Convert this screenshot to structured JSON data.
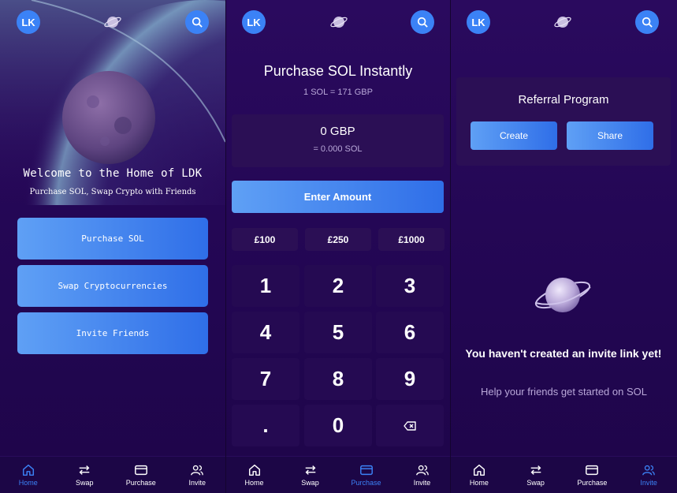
{
  "colors": {
    "accent": "#3b82f6",
    "bg": "#220652",
    "card": "#2b0f55"
  },
  "avatar_initials": "LK",
  "nav": [
    {
      "label": "Home",
      "icon": "home-icon"
    },
    {
      "label": "Swap",
      "icon": "swap-icon"
    },
    {
      "label": "Purchase",
      "icon": "card-icon"
    },
    {
      "label": "Invite",
      "icon": "users-icon"
    }
  ],
  "home": {
    "welcome": "Welcome to the Home of LDK",
    "subtitle": "Purchase SOL, Swap Crypto with Friends",
    "buttons": [
      "Purchase SOL",
      "Swap Cryptocurrencies",
      "Invite Friends"
    ],
    "active_nav": "Home"
  },
  "purchase": {
    "title": "Purchase SOL Instantly",
    "rate": "1 SOL = 171 GBP",
    "amount_gbp": "0 GBP",
    "amount_sol": "= 0.000 SOL",
    "enter_button": "Enter Amount",
    "quick_amounts": [
      "£100",
      "£250",
      "£1000"
    ],
    "keys": [
      "1",
      "2",
      "3",
      "4",
      "5",
      "6",
      "7",
      "8",
      "9",
      ".",
      "0"
    ],
    "active_nav": "Purchase"
  },
  "invite": {
    "card_title": "Referral Program",
    "create_button": "Create",
    "share_button": "Share",
    "empty_title": "You haven't created an invite link yet!",
    "empty_subtitle": "Help your friends get started on SOL",
    "active_nav": "Invite"
  }
}
